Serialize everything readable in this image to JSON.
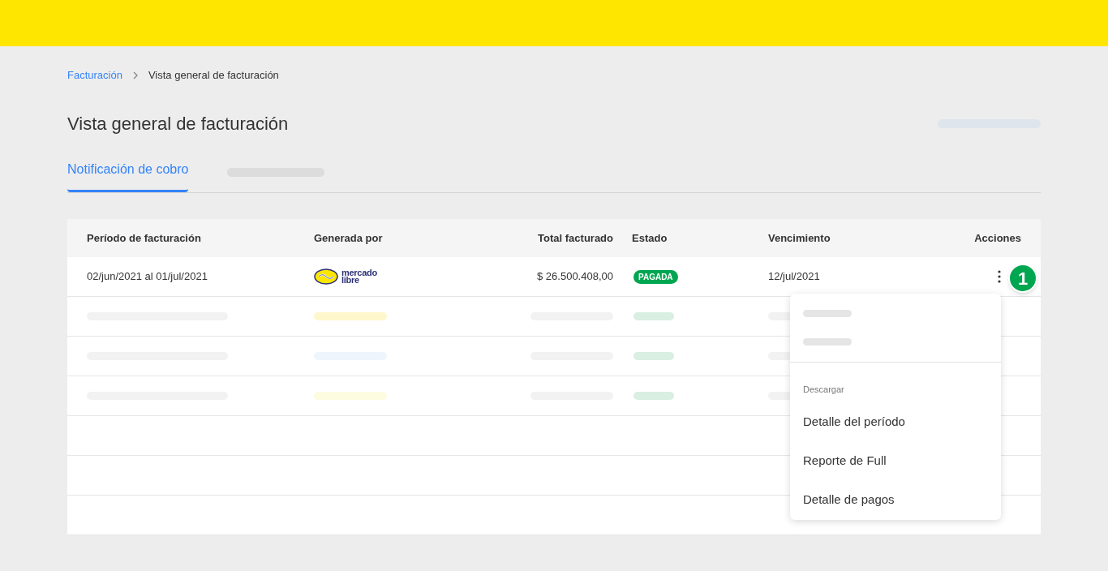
{
  "breadcrumb": [
    {
      "label": "Facturación",
      "link": true
    },
    {
      "label": "Vista general de facturación",
      "link": false
    }
  ],
  "title": "Vista general de facturación",
  "tabs": [
    {
      "label": "Notificación de cobro",
      "selected": true
    },
    {
      "selected": false,
      "kind": "skeleton"
    }
  ],
  "table": {
    "columns": [
      "Período de facturación",
      "Generada por",
      "Total facturado",
      "Estado",
      "Vencimiento",
      "Acciones"
    ],
    "rows": [
      {
        "kind": "data",
        "period": "02/jun/2021 al 01/jul/2021",
        "generated_by": {
          "line1": "mercado",
          "line2": "libre"
        },
        "total": "$ 26.500.408,00",
        "status": "PAGADA",
        "due": "12/jul/2021"
      },
      {
        "kind": "skeleton",
        "color": "#fff7cc"
      },
      {
        "kind": "skeleton",
        "color": "#eef5fb"
      },
      {
        "kind": "skeleton",
        "color": "#fdfbe0"
      },
      {
        "kind": "empty"
      },
      {
        "kind": "empty"
      },
      {
        "kind": "empty"
      }
    ]
  },
  "step_badge": "1",
  "menu": {
    "section": "Descargar",
    "items": [
      "Detalle del período",
      "Reporte de Full",
      "Detalle de pagos"
    ]
  }
}
